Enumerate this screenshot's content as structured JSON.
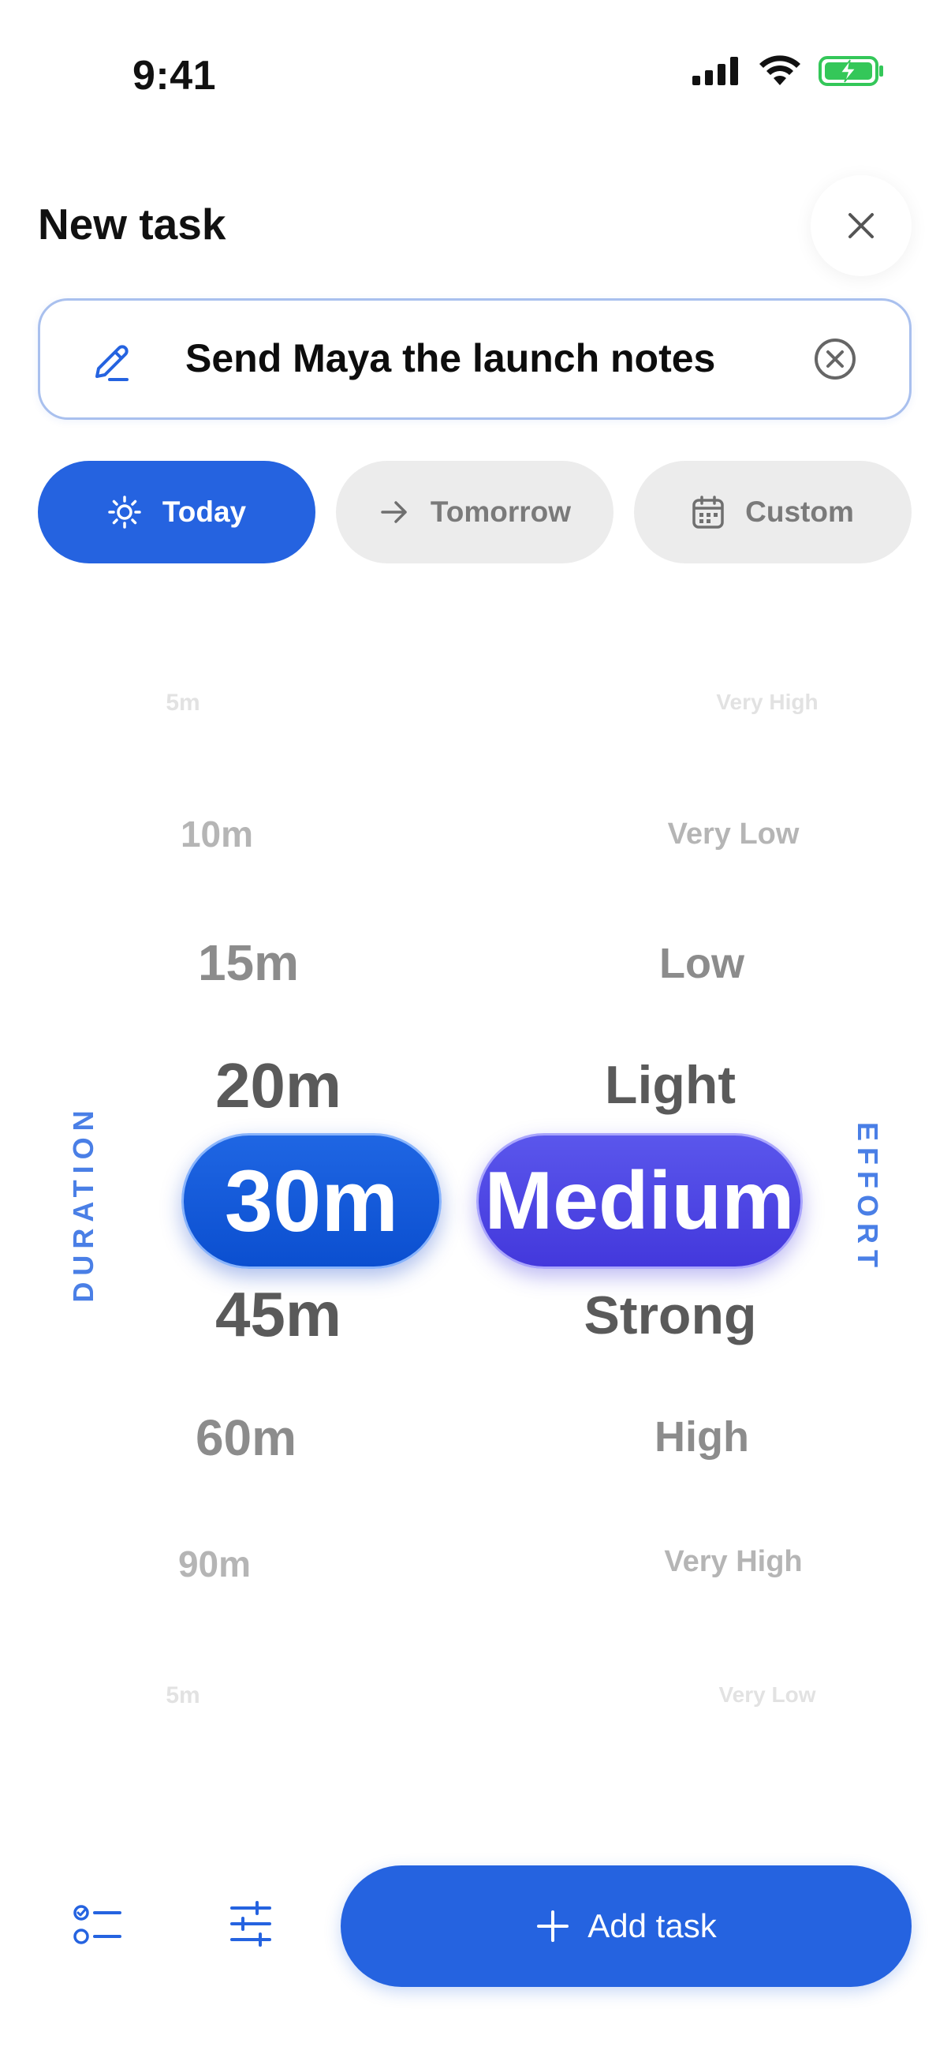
{
  "status_bar": {
    "time": "9:41"
  },
  "header": {
    "title": "New task"
  },
  "task_input": {
    "value": "Send Maya the launch notes"
  },
  "date_chips": [
    {
      "label": "Today",
      "icon": "sun-icon",
      "selected": true
    },
    {
      "label": "Tomorrow",
      "icon": "arrow-right-icon",
      "selected": false
    },
    {
      "label": "Custom",
      "icon": "calendar-icon",
      "selected": false
    }
  ],
  "duration_picker": {
    "label": "DURATION",
    "above": [
      "5m",
      "10m",
      "15m",
      "20m"
    ],
    "selected": "30m",
    "below": [
      "45m",
      "60m",
      "90m",
      "5m"
    ]
  },
  "effort_picker": {
    "label": "EFFORT",
    "above": [
      "Very High",
      "Very Low",
      "Low",
      "Light"
    ],
    "selected": "Medium",
    "below": [
      "Strong",
      "High",
      "Very High",
      "Very Low"
    ]
  },
  "bottom_bar": {
    "add_label": "Add task",
    "icons": [
      "checklist-icon",
      "sliders-icon"
    ]
  },
  "colors": {
    "primary": "#2563e0",
    "effort_accent": "#4a3fe0",
    "chip_inactive": "#ececec",
    "battery_green": "#34c759"
  }
}
